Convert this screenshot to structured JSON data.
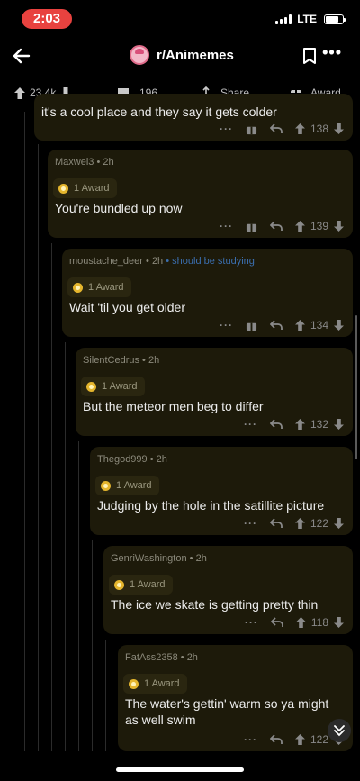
{
  "status": {
    "time": "2:03",
    "network": "LTE"
  },
  "header": {
    "subreddit": "r/Animemes"
  },
  "post_actions": {
    "upvotes": "23.4k",
    "comments": "196",
    "share": "Share",
    "award": "Award"
  },
  "partial_comment": {
    "text": "it's a cool place and they say it gets colder",
    "score": "138"
  },
  "comments": [
    {
      "author": "Maxwel3",
      "time": "2h",
      "flair": "",
      "award": "1 Award",
      "lines": [
        "You're bundled up now"
      ],
      "score": "139"
    },
    {
      "author": "moustache_deer",
      "time": "2h",
      "flair": "should be studying",
      "award": "1 Award",
      "lines": [
        "Wait 'til you get older"
      ],
      "score": "134"
    },
    {
      "author": "SilentCedrus",
      "time": "2h",
      "flair": "",
      "award": "1 Award",
      "lines": [
        "But the meteor men beg to differ"
      ],
      "score": "132"
    },
    {
      "author": "Thegod999",
      "time": "2h",
      "flair": "",
      "award": "1 Award",
      "lines": [
        "Judging by the hole in the satillite picture"
      ],
      "score": "122"
    },
    {
      "author": "GenriWashington",
      "time": "2h",
      "flair": "",
      "award": "1 Award",
      "lines": [
        "The ice we skate is getting pretty thin"
      ],
      "score": "118"
    },
    {
      "author": "FatAss2358",
      "time": "2h",
      "flair": "",
      "award": "1 Award",
      "lines": [
        "The water's gettin' warm so ya might",
        "as well swim"
      ],
      "score": "122"
    }
  ]
}
